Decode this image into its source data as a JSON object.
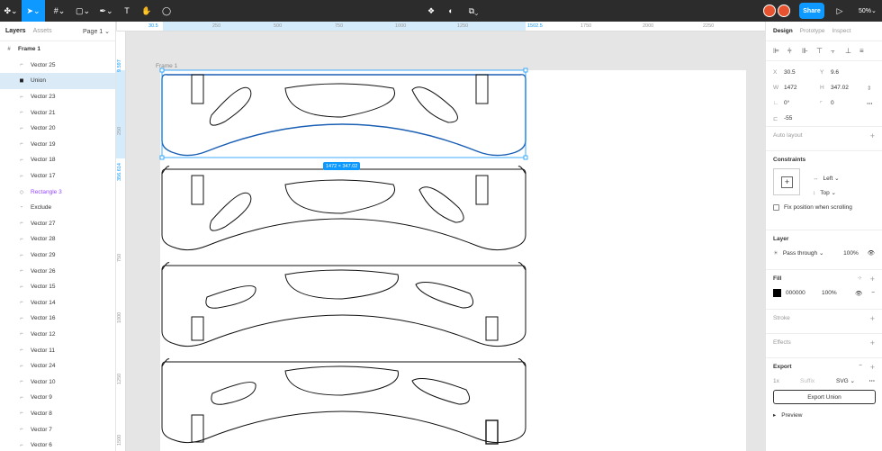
{
  "toolbar": {
    "share_label": "Share",
    "zoom_label": "50%"
  },
  "left_panel": {
    "tabs": [
      "Layers",
      "Assets"
    ],
    "page_label": "Page 1",
    "frame_name": "Frame 1",
    "layers": [
      {
        "name": "Vector 25",
        "icon": "vector-icon",
        "selected": false
      },
      {
        "name": "Union",
        "icon": "union-icon",
        "selected": true
      },
      {
        "name": "Vector 23",
        "icon": "vector-icon",
        "selected": false
      },
      {
        "name": "Vector 21",
        "icon": "vector-icon",
        "selected": false
      },
      {
        "name": "Vector 20",
        "icon": "vector-icon",
        "selected": false
      },
      {
        "name": "Vector 19",
        "icon": "vector-icon",
        "selected": false
      },
      {
        "name": "Vector 18",
        "icon": "vector-icon",
        "selected": false
      },
      {
        "name": "Vector 17",
        "icon": "vector-icon",
        "selected": false
      },
      {
        "name": "Rectangle 3",
        "icon": "component-icon",
        "selected": false
      },
      {
        "name": "Exclude",
        "icon": "exclude-icon",
        "selected": false
      },
      {
        "name": "Vector 27",
        "icon": "vector-icon",
        "selected": false
      },
      {
        "name": "Vector 28",
        "icon": "vector-icon",
        "selected": false
      },
      {
        "name": "Vector 29",
        "icon": "vector-icon",
        "selected": false
      },
      {
        "name": "Vector 26",
        "icon": "vector-icon",
        "selected": false
      },
      {
        "name": "Vector 15",
        "icon": "vector-icon",
        "selected": false
      },
      {
        "name": "Vector 14",
        "icon": "vector-icon",
        "selected": false
      },
      {
        "name": "Vector 16",
        "icon": "vector-icon",
        "selected": false
      },
      {
        "name": "Vector 12",
        "icon": "vector-icon",
        "selected": false
      },
      {
        "name": "Vector 11",
        "icon": "vector-icon",
        "selected": false
      },
      {
        "name": "Vector 24",
        "icon": "vector-icon",
        "selected": false
      },
      {
        "name": "Vector 10",
        "icon": "vector-icon",
        "selected": false
      },
      {
        "name": "Vector 9",
        "icon": "vector-icon",
        "selected": false
      },
      {
        "name": "Vector 8",
        "icon": "vector-icon",
        "selected": false
      },
      {
        "name": "Vector 7",
        "icon": "vector-icon",
        "selected": false
      },
      {
        "name": "Vector 6",
        "icon": "vector-icon",
        "selected": false
      }
    ]
  },
  "ruler": {
    "top_ticks": [
      "30.5",
      "250",
      "500",
      "750",
      "1000",
      "1250",
      "1502.5",
      "1750",
      "2000",
      "2250"
    ],
    "left_ticks": [
      "9.597",
      "250",
      "356.614",
      "750",
      "1000",
      "1250",
      "1500"
    ]
  },
  "canvas": {
    "frame_label": "Frame 1",
    "selection_size": "1472 × 347.02"
  },
  "right_panel": {
    "tabs": [
      "Design",
      "Prototype",
      "Inspect"
    ],
    "x_label": "X",
    "x_value": "30.5",
    "y_label": "Y",
    "y_value": "9.6",
    "w_label": "W",
    "w_value": "1472",
    "h_label": "H",
    "h_value": "347.02",
    "rotation_value": "0°",
    "radius_value": "0",
    "extra_value": "-55",
    "auto_layout_label": "Auto layout",
    "constraints_label": "Constraints",
    "constraint_h": "Left",
    "constraint_v": "Top",
    "fix_position_label": "Fix position when scrolling",
    "layer_label": "Layer",
    "blend_mode": "Pass through",
    "layer_opacity": "100%",
    "fill_label": "Fill",
    "fill_hex": "000000",
    "fill_opacity": "100%",
    "stroke_label": "Stroke",
    "effects_label": "Effects",
    "export_label": "Export",
    "export_scale": "1x",
    "export_suffix_placeholder": "Suffix",
    "export_format": "SVG",
    "export_button": "Export Union",
    "preview_label": "Preview"
  },
  "colors": {
    "accent": "#0d99ff",
    "toolbar_bg": "#2c2c2c",
    "selected_row": "#daebf7"
  }
}
